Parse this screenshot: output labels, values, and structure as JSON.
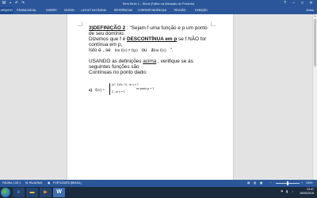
{
  "titlebar": {
    "title": "Sem título 1 - Word (Falha na Ativação do Produto)",
    "qat_icons": [
      "word-logo-icon",
      "save-icon",
      "undo-icon",
      "redo-icon"
    ],
    "controls": [
      "?",
      "–",
      "□",
      "✕"
    ]
  },
  "ribbon": {
    "tabs": [
      "ARQUIVO",
      "PÁGINA INICIAL",
      "INSERIR",
      "DESIGN",
      "LAYOUT DA PÁGINA",
      "REFERÊNCIAS",
      "CORRESPONDÊNCIAS",
      "REVISÃO",
      "EXIBIÇÃO"
    ],
    "signin": "Entrar"
  },
  "document": {
    "l1_heading": "3)DEFINIÇÃO 2",
    "l1_rest": " : \"Sejam f uma função e p um ponto",
    "l2": "de seu domínio.",
    "l3_a": "Dizemos que f é ",
    "l3_b": "DESCONTÍNUA em p",
    "l3_c": " se f NÃO for",
    "l4": "contínua em p,",
    "l5_a": "Isto é , se",
    "l5_lim1": "lim f(x) ≠ f(p)",
    "l5_mid": "ou",
    "l5_lim2": "∄lim f(x)",
    "l5_end": "\".",
    "l6_a": "USANDO as definições ",
    "l6_b": "acima",
    "l6_c": " , verifique se as",
    "l7": "seguintes funções são",
    "l8": "Contínuas no ponto dado:",
    "ex_label": "a)",
    "ex_f": "f(x) =",
    "ex_case1": "(x²−1)/(x−1) , se x ≠ 1",
    "ex_case2": "2 , se x = 1",
    "ex_point": "no ponto p = 1 ."
  },
  "statusbar": {
    "page": "PÁGINA 1 DE 1",
    "words": "91 PALAVRAS",
    "language": "PORTUGUÊS (BRASIL)",
    "zoom": "100%"
  },
  "taskbar": {
    "time": "13:47",
    "date": "18/05/2016"
  }
}
